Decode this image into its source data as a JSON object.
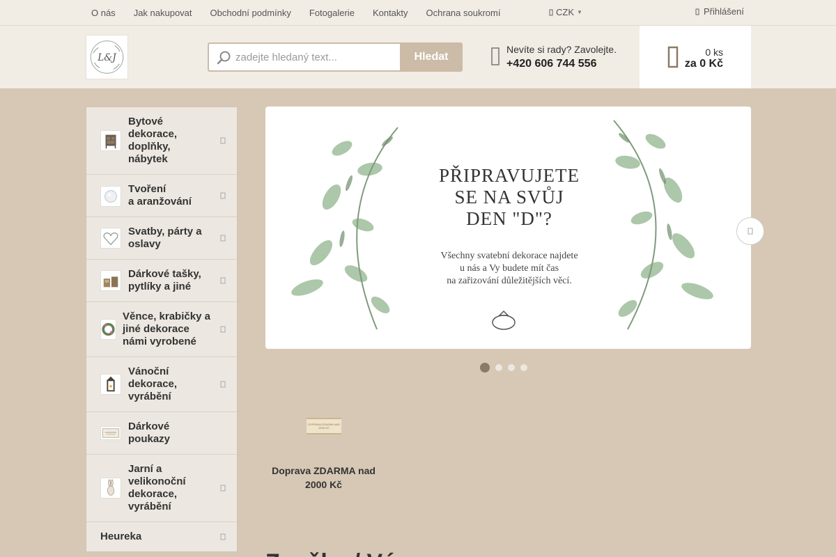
{
  "topbar": {
    "nav": [
      "O nás",
      "Jak nakupovat",
      "Obchodní podmínky",
      "Fotogalerie",
      "Kontakty",
      "Ochrana soukromí"
    ],
    "currency": "CZK",
    "login": "Přihlášení"
  },
  "header": {
    "logo_text": "L&J",
    "search_placeholder": "zadejte hledaný text...",
    "search_button": "Hledat",
    "contact_question": "Nevíte si rady? Zavolejte.",
    "contact_phone": "+420 606 744 556",
    "cart_qty": "0 ks",
    "cart_sum": "za 0 Kč"
  },
  "sidebar": {
    "categories": [
      {
        "lines": [
          "Bytové",
          "dekorace,",
          "doplňky,",
          "nábytek"
        ]
      },
      {
        "lines": [
          "Tvoření",
          "a aranžování"
        ]
      },
      {
        "lines": [
          "Svatby, párty a",
          "oslavy"
        ]
      },
      {
        "lines": [
          "Dárkové tašky,",
          "pytlíky a jiné"
        ]
      },
      {
        "lines": [
          "Věnce, krabičky a",
          "jiné dekorace",
          "námi vyrobené"
        ]
      },
      {
        "lines": [
          "Vánoční",
          "dekorace,",
          "vyrábění"
        ]
      },
      {
        "lines": [
          "Dárkové",
          "poukazy"
        ]
      },
      {
        "lines": [
          "Jarní a",
          "velikonoční",
          "dekorace,",
          "vyrábění"
        ]
      },
      {
        "lines": [
          "Heureka"
        ]
      }
    ]
  },
  "banner": {
    "headline": [
      "PŘIPRAVUJETE",
      "SE NA SVŮJ",
      "DEN \"D\"?"
    ],
    "subtext": [
      "Všechny svatební dekorace najdete",
      "u nás a Vy budete mít čas",
      "na zařizování důležitějších věcí."
    ],
    "slide_count": 4,
    "active_slide": 1
  },
  "benefit": {
    "image_text": "DOPRAVA ZDARMA NAD 2000 KČ",
    "text_lines": [
      "Doprava ZDARMA nad",
      "2000 Kč"
    ]
  },
  "section_title": "Značky / Výr..."
}
